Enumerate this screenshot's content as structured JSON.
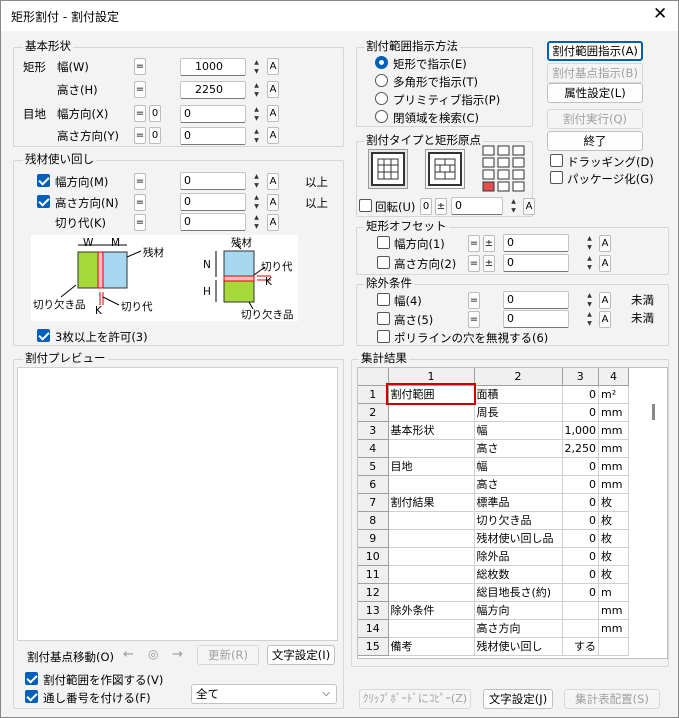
{
  "title": "矩形割付 - 割付設定",
  "basic": {
    "group": "基本形状",
    "rect": "矩形",
    "width": "幅(W)",
    "height": "高さ(H)",
    "joint": "目地",
    "jw": "幅方向(X)",
    "jh": "高さ方向(Y)",
    "width_val": "1000",
    "height_val": "2250",
    "jw_val": "0",
    "jh_val": "0",
    "zero": "0",
    "eq": "=",
    "a": "A"
  },
  "rem": {
    "group": "残材使い回し",
    "wdir": "幅方向(M)",
    "hdir": "高さ方向(N)",
    "cut": "切り代(K)",
    "wdir_val": "0",
    "hdir_val": "0",
    "cut_val": "0",
    "over": "以上",
    "allow3": "3枚以上を許可(3)"
  },
  "diagram": {
    "W": "W",
    "M": "M",
    "N": "N",
    "H": "H",
    "K": "K",
    "zanzai1": "残材",
    "kirikaki1": "切り欠き品",
    "kirishiro1": "切り代",
    "zanzai2": "残材",
    "kirishiro2": "切り代",
    "kirikaki2": "切り欠き品"
  },
  "range": {
    "group": "割付範囲指示方法",
    "opt1": "矩形で指示(E)",
    "opt2": "多角形で指示(T)",
    "opt3": "プリミティブ指示(P)",
    "opt4": "閉領域を検索(C)"
  },
  "buttons": {
    "range": "割付範囲指示(A)",
    "base": "割付基点指示(B)",
    "attr": "属性設定(L)",
    "exec": "割付実行(Q)",
    "end": "終了",
    "drag": "ドラッギング(D)",
    "pkg": "パッケージ化(G)"
  },
  "type": {
    "group": "割付タイプと矩形原点",
    "rotate": "回転(U)",
    "rot_zero": "0",
    "pm": "±",
    "rot_val": "0"
  },
  "offset": {
    "group": "矩形オフセット",
    "wdir": "幅方向(1)",
    "hdir": "高さ方向(2)",
    "wval": "0",
    "hval": "0",
    "pm": "±"
  },
  "excl": {
    "group": "除外条件",
    "w": "幅(4)",
    "h": "高さ(5)",
    "wval": "0",
    "hval": "0",
    "under": "未満",
    "poly": "ポリラインの穴を無視する(6)"
  },
  "preview": {
    "group": "割付プレビュー",
    "move": "割付基点移動(O)",
    "left": "←",
    "center": "◎",
    "right": "→",
    "update": "更新(R)",
    "font": "文字設定(I)",
    "draw": "割付範囲を作図する(V)",
    "serial": "通し番号を付ける(F)",
    "all": "全て"
  },
  "result": {
    "group": "集計結果",
    "cols": [
      "1",
      "2",
      "3",
      "4"
    ],
    "rows": [
      [
        "1",
        "割付範囲",
        "面積",
        "0",
        "m²"
      ],
      [
        "2",
        "",
        "周長",
        "0",
        "mm"
      ],
      [
        "3",
        "基本形状",
        "幅",
        "1,000",
        "mm"
      ],
      [
        "4",
        "",
        "高さ",
        "2,250",
        "mm"
      ],
      [
        "5",
        "目地",
        "幅",
        "0",
        "mm"
      ],
      [
        "6",
        "",
        "高さ",
        "0",
        "mm"
      ],
      [
        "7",
        "割付結果",
        "標準品",
        "0",
        "枚"
      ],
      [
        "8",
        "",
        "切り欠き品",
        "0",
        "枚"
      ],
      [
        "9",
        "",
        "残材使い回し品",
        "0",
        "枚"
      ],
      [
        "10",
        "",
        "除外品",
        "0",
        "枚"
      ],
      [
        "11",
        "",
        "総枚数",
        "0",
        "枚"
      ],
      [
        "12",
        "",
        "総目地長さ(約)",
        "0",
        "m"
      ],
      [
        "13",
        "除外条件",
        "幅方向",
        "",
        "mm"
      ],
      [
        "14",
        "",
        "高さ方向",
        "",
        "mm"
      ],
      [
        "15",
        "備考",
        "残材使い回し",
        "する",
        ""
      ]
    ],
    "copy": "ｸﾘｯﾌﾟﾎﾞｰﾄﾞにｺﾋﾟｰ(Z)",
    "font": "文字設定(J)",
    "place": "集計表配置(S)"
  }
}
